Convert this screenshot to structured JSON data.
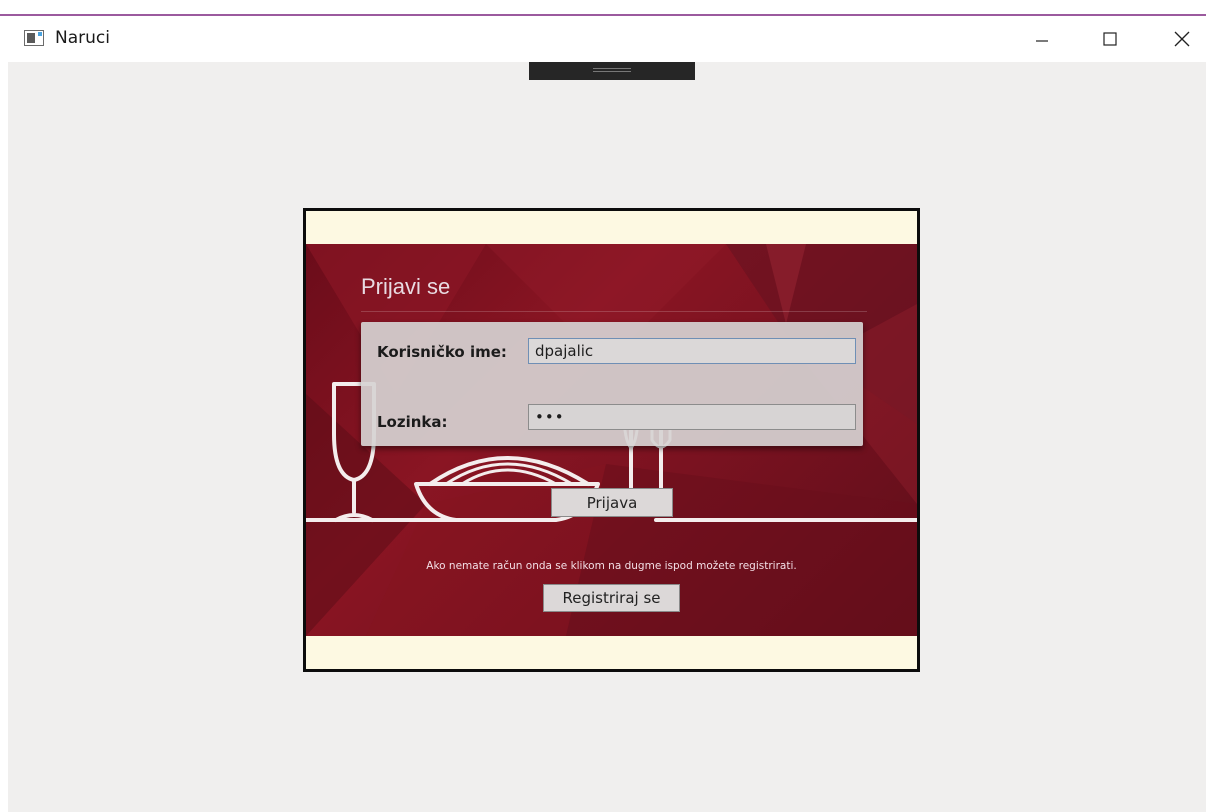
{
  "window": {
    "title": "Naruci",
    "controls": [
      "minimize",
      "maximize",
      "close"
    ]
  },
  "login": {
    "heading": "Prijavi se",
    "username_label": "Korisničko ime:",
    "username_value": "dpajalic",
    "password_label": "Lozinka:",
    "password_value": "•••",
    "login_button": "Prijava",
    "register_hint": "Ako nemate račun onda se klikom na dugme ispod možete registrirati.",
    "register_button": "Registriraj se"
  },
  "icons": {
    "app": "window-app-icon",
    "minimize": "minimize-icon",
    "maximize": "maximize-icon",
    "close": "close-icon",
    "illustration": "wine-pasta-cutlery-illustration"
  },
  "colors": {
    "panel_background": "#7a1220",
    "client_background": "#f0efee",
    "frame_background": "#fdf9e2",
    "title_bar_accent": "#9b5a9e"
  }
}
